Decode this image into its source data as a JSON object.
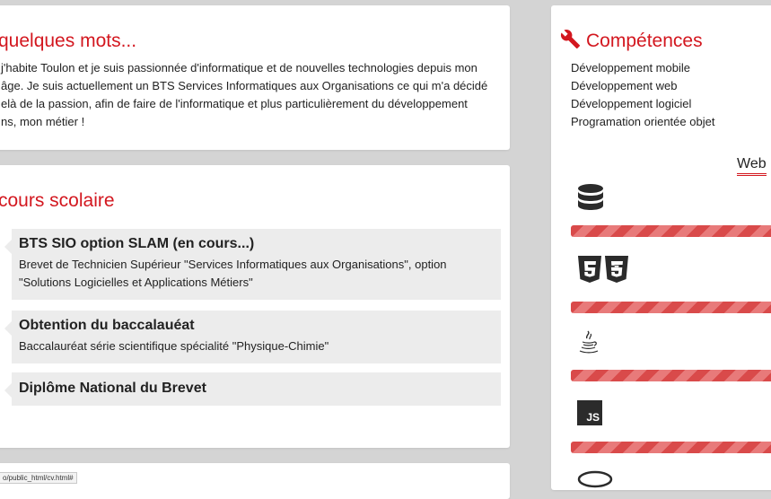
{
  "about": {
    "title": "quelques mots...",
    "lines": [
      "j'habite Toulon et je suis passionnée d'informatique et de nouvelles technologies depuis mon",
      "âge. Je suis actuellement un BTS Services Informatiques aux Organisations ce qui m'a décidé",
      "elà de la passion, afin de faire de l'informatique et plus particulièrement du développement",
      "ns, mon métier !"
    ]
  },
  "school": {
    "title": "cours scolaire",
    "entries": [
      {
        "title": "BTS SIO option SLAM (en cours...)",
        "lines": [
          "Brevet de Technicien Supérieur \"Services Informatiques aux Organisations\", option",
          "\"Solutions Logicielles et Applications Métiers\""
        ]
      },
      {
        "title": "Obtention du baccalauéat",
        "lines": [
          "Baccalauréat série scientifique spécialité \"Physique-Chimie\""
        ]
      },
      {
        "title": "Diplôme National du Brevet",
        "lines": []
      }
    ]
  },
  "skills": {
    "title": "Compétences",
    "items": [
      "Développement mobile",
      "Développement web",
      "Développement logiciel",
      "Programation orientée objet"
    ],
    "tab": "Web",
    "techs": [
      {
        "icon": "database-icon",
        "level": 1.0
      },
      {
        "icon": "html5-css3-icon",
        "level": 1.0
      },
      {
        "icon": "java-icon",
        "level": 1.0
      },
      {
        "icon": "javascript-icon",
        "level": 1.0
      }
    ],
    "js_icon_text": "JS"
  },
  "status": {
    "url": "o/public_html/cv.html#"
  },
  "colors": {
    "accent": "#d3171f",
    "background": "#d4d4d4",
    "entry_bg": "#ececec",
    "bar": "#d94a4a"
  }
}
